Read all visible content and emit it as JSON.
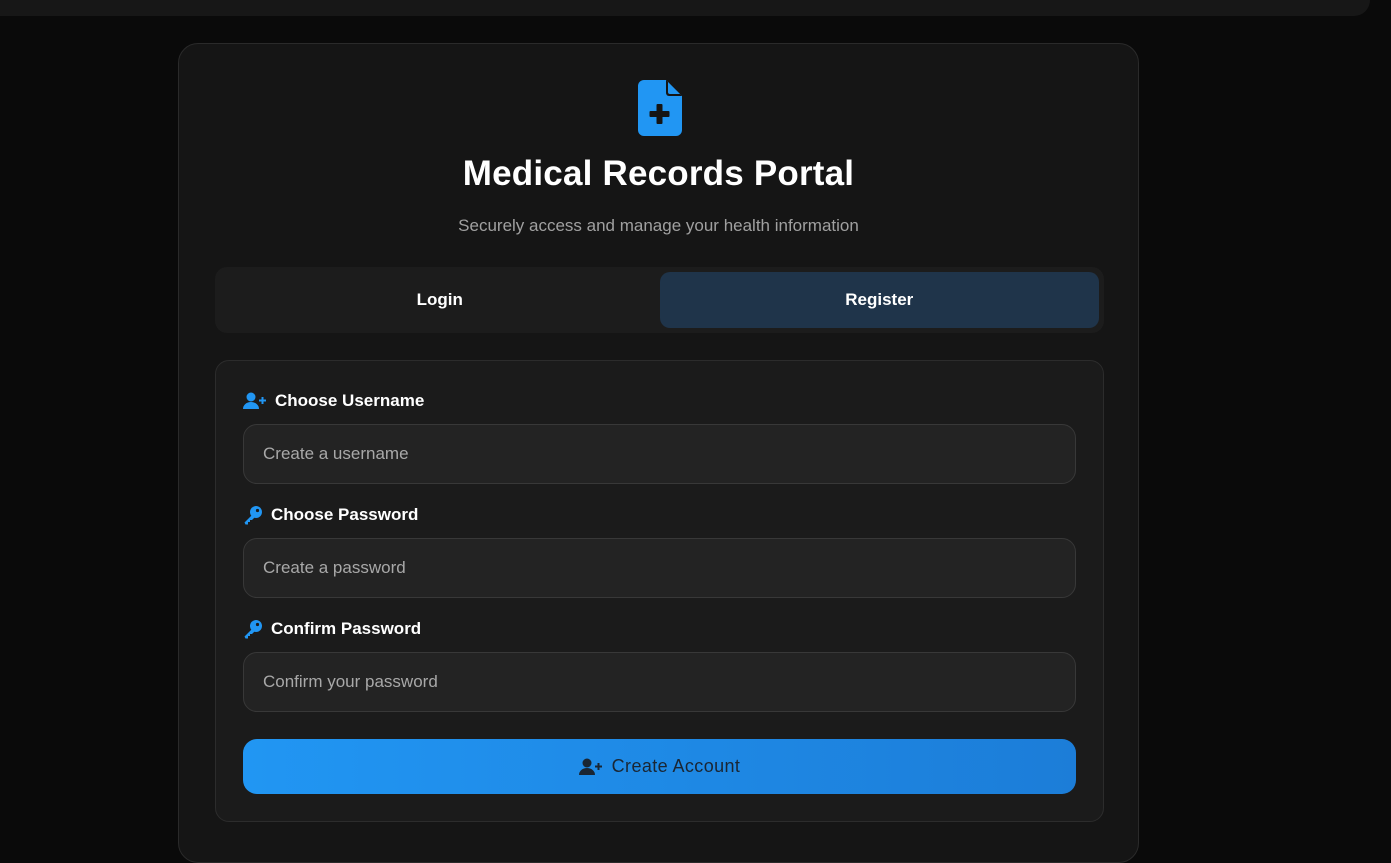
{
  "header": {
    "logo_icon": "file-medical-icon",
    "title": "Medical Records Portal",
    "subtitle": "Securely access and manage your health information"
  },
  "tabs": [
    {
      "label": "Login",
      "active": false
    },
    {
      "label": "Register",
      "active": true
    }
  ],
  "form": {
    "username": {
      "icon": "user-plus-icon",
      "label": "Choose Username",
      "placeholder": "Create a username",
      "value": ""
    },
    "password": {
      "icon": "key-icon",
      "label": "Choose Password",
      "placeholder": "Create a password",
      "value": ""
    },
    "confirm": {
      "icon": "key-icon",
      "label": "Confirm Password",
      "placeholder": "Confirm your password",
      "value": ""
    },
    "submit": {
      "icon": "user-plus-icon",
      "label": "Create Account"
    }
  },
  "colors": {
    "accent": "#2196f3",
    "active_tab": "#1f344a",
    "background": "#0a0a0a",
    "card": "#151515"
  }
}
